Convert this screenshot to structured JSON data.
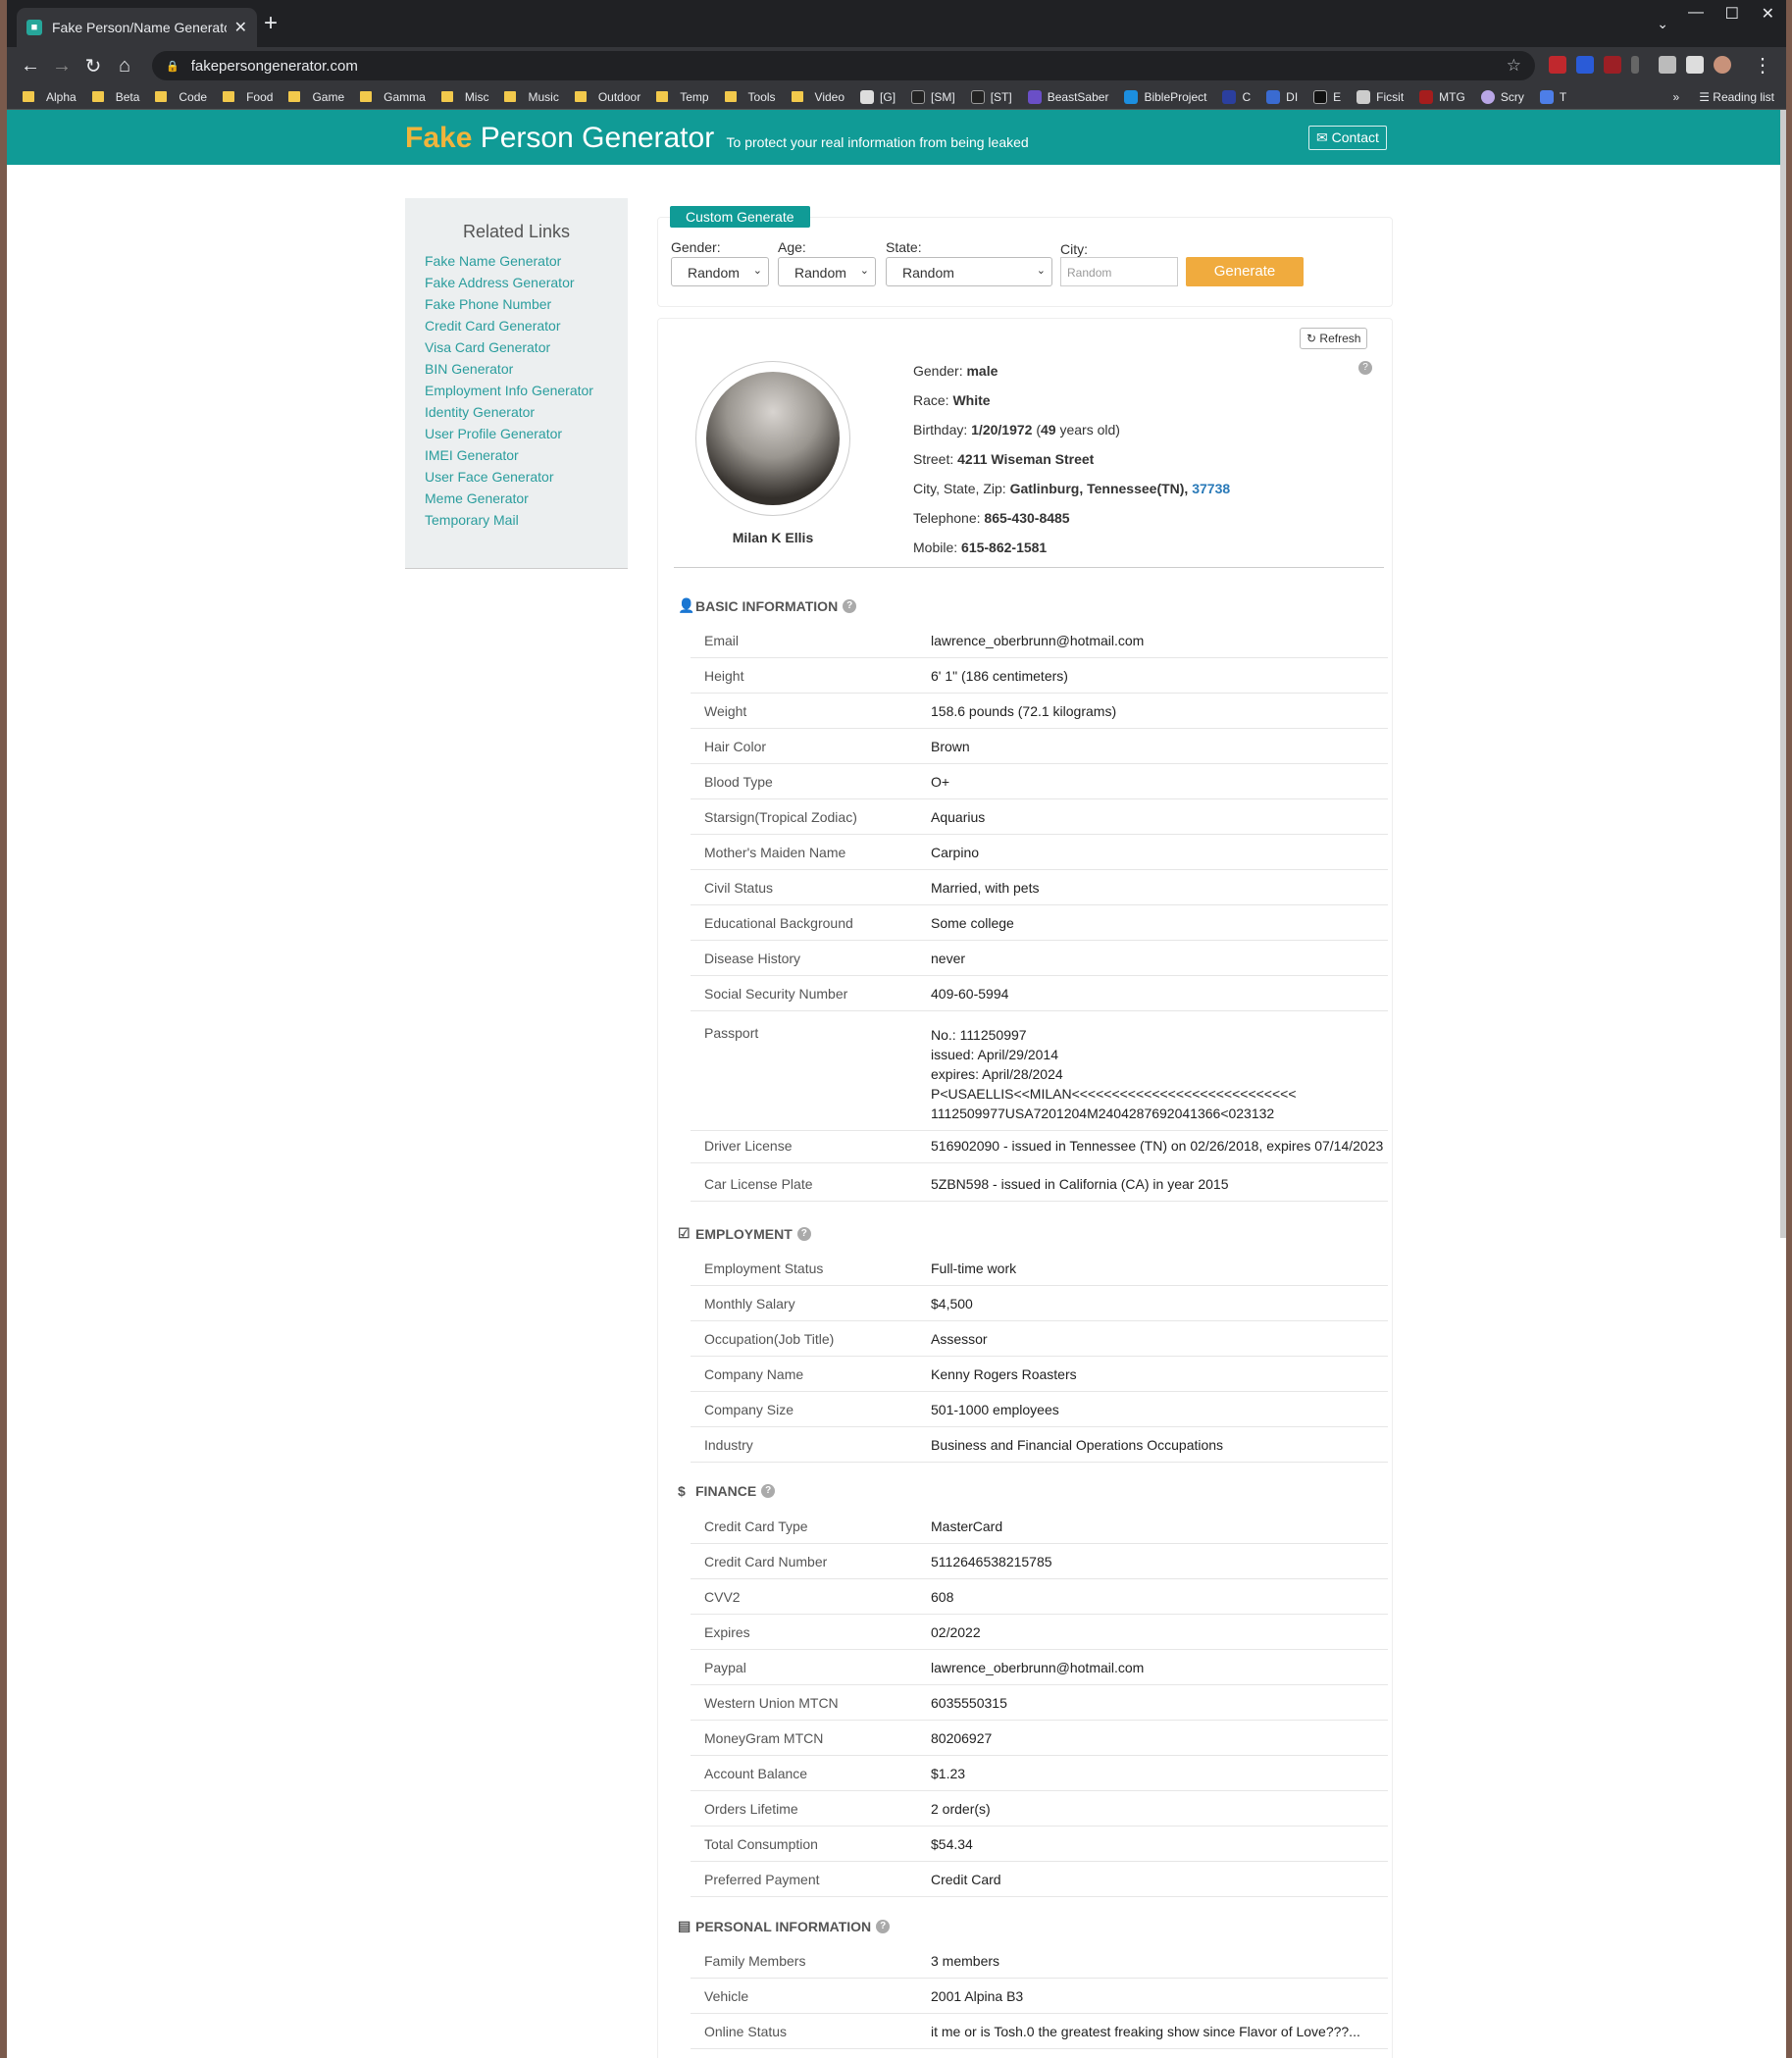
{
  "browser": {
    "tab_title": "Fake Person/Name Generator | U",
    "url": "fakepersongenerator.com",
    "bookmarks": [
      "Alpha",
      "Beta",
      "Code",
      "Food",
      "Game",
      "Gamma",
      "Misc",
      "Music",
      "Outdoor",
      "Temp",
      "Tools",
      "Video",
      "[G]",
      "[SM]",
      "[ST]",
      "BeastSaber",
      "BibleProject",
      "C",
      "DI",
      "E",
      "Ficsit",
      "MTG",
      "Scry",
      "T"
    ],
    "reading_list": "Reading list"
  },
  "site": {
    "brand_fake": "Fake",
    "brand_rest": " Person Generator",
    "tagline": "To protect your real information from being leaked",
    "contact": "Contact"
  },
  "sidebar": {
    "title": "Related Links",
    "links": [
      "Fake Name Generator",
      "Fake Address Generator",
      "Fake Phone Number",
      "Credit Card Generator",
      "Visa Card Generator",
      "BIN Generator",
      "Employment Info Generator",
      "Identity Generator",
      "User Profile Generator",
      "IMEI Generator",
      "User Face Generator",
      "Meme Generator",
      "Temporary Mail"
    ]
  },
  "custom": {
    "label": "Custom Generate",
    "gender_label": "Gender:",
    "age_label": "Age:",
    "state_label": "State:",
    "city_label": "City:",
    "gender": "Random",
    "age": "Random",
    "state": "Random",
    "city_placeholder": "Random",
    "generate": "Generate"
  },
  "profile": {
    "refresh": "Refresh",
    "name": "Milan K Ellis",
    "gender_k": "Gender:",
    "gender": "male",
    "race_k": "Race:",
    "race": "White",
    "birthday_k": "Birthday:",
    "birthday": "1/20/1972",
    "age": "49",
    "age_suffix": " years old)",
    "street_k": "Street:",
    "street": "4211 Wiseman Street",
    "csz_k": "City, State, Zip:",
    "csz": "Gatlinburg, Tennessee(TN),",
    "zip": "37738",
    "tel_k": "Telephone:",
    "tel": "865-430-8485",
    "mob_k": "Mobile:",
    "mob": "615-862-1581"
  },
  "sections": {
    "basic": "BASIC INFORMATION",
    "employment": "EMPLOYMENT",
    "finance": "FINANCE",
    "personal": "PERSONAL INFORMATION"
  },
  "basic": [
    [
      "Email",
      "lawrence_oberbrunn@hotmail.com"
    ],
    [
      "Height",
      "6' 1\" (186 centimeters)"
    ],
    [
      "Weight",
      "158.6 pounds (72.1 kilograms)"
    ],
    [
      "Hair Color",
      "Brown"
    ],
    [
      "Blood Type",
      "O+"
    ],
    [
      "Starsign(Tropical Zodiac)",
      "Aquarius"
    ],
    [
      "Mother's Maiden Name",
      "Carpino"
    ],
    [
      "Civil Status",
      "Married, with pets"
    ],
    [
      "Educational Background",
      "Some college"
    ],
    [
      "Disease History",
      "never"
    ],
    [
      "Social Security Number",
      "409-60-5994"
    ]
  ],
  "passport": {
    "k": "Passport",
    "v": "No.: 111250997\nissued: April/29/2014\nexpires: April/28/2024\nP<USAELLIS<<MILAN<<<<<<<<<<<<<<<<<<<<<<<<<<<<\n1112509977USA7201204M2404287692041366<023132"
  },
  "license": [
    [
      "Driver License",
      "516902090 - issued in Tennessee (TN) on 02/26/2018, expires 07/14/2023"
    ],
    [
      "Car License Plate",
      "5ZBN598 - issued in California (CA) in year 2015"
    ]
  ],
  "employment": [
    [
      "Employment Status",
      "Full-time work"
    ],
    [
      "Monthly Salary",
      "$4,500"
    ],
    [
      "Occupation(Job Title)",
      "Assessor"
    ],
    [
      "Company Name",
      "Kenny Rogers Roasters"
    ],
    [
      "Company Size",
      "501-1000 employees"
    ],
    [
      "Industry",
      "Business and Financial Operations Occupations"
    ]
  ],
  "finance": [
    [
      "Credit Card Type",
      "MasterCard"
    ],
    [
      "Credit Card Number",
      "5112646538215785"
    ],
    [
      "CVV2",
      "608"
    ],
    [
      "Expires",
      "02/2022"
    ],
    [
      "Paypal",
      "lawrence_oberbrunn@hotmail.com"
    ],
    [
      "Western Union MTCN",
      "6035550315"
    ],
    [
      "MoneyGram MTCN",
      "80206927"
    ],
    [
      "Account Balance",
      "$1.23"
    ],
    [
      "Orders Lifetime",
      "2 order(s)"
    ],
    [
      "Total Consumption",
      "$54.34"
    ],
    [
      "Preferred Payment",
      "Credit Card"
    ]
  ],
  "personal": [
    [
      "Family Members",
      "3 members"
    ],
    [
      "Vehicle",
      "2001 Alpina B3"
    ],
    [
      "Online Status",
      "it me or is Tosh.0 the greatest freaking show since Flavor of Love???..."
    ]
  ]
}
